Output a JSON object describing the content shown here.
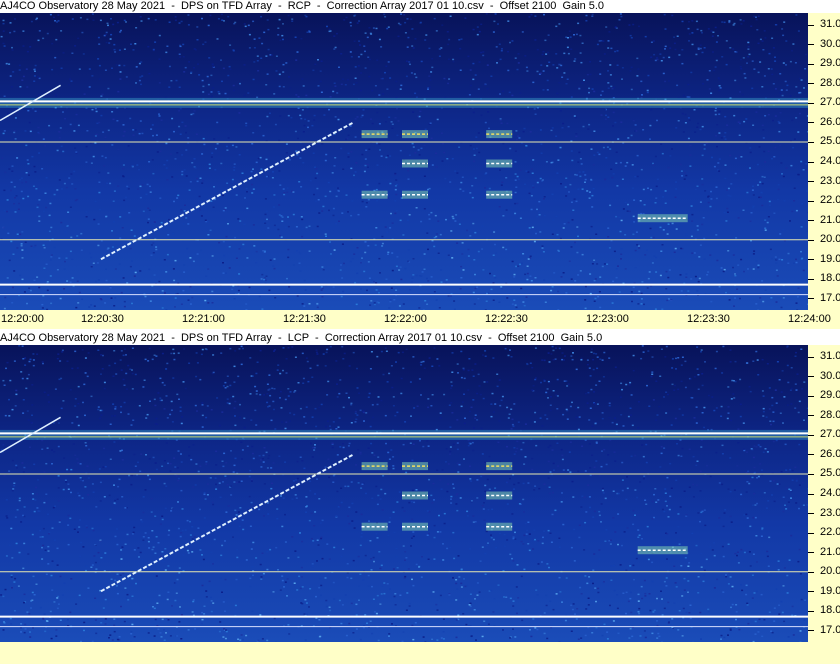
{
  "chart_data": [
    {
      "type": "heatmap",
      "title": "AJ4CO Observatory 28 May 2021  -  DPS on TFD Array  -  RCP  -  Correction Array 2017 01 10.csv  -  Offset 2100  Gain 5.0",
      "x_ticks": [
        "12:20:00",
        "12:20:30",
        "12:21:00",
        "12:21:30",
        "12:22:00",
        "12:22:30",
        "12:23:00",
        "12:23:30",
        "12:24:00"
      ],
      "y_ticks": [
        "31.0",
        "30.0",
        "29.0",
        "28.0",
        "27.0",
        "26.0",
        "25.0",
        "24.0",
        "23.0",
        "22.0",
        "21.0",
        "20.0",
        "19.0",
        "18.0",
        "17.0"
      ],
      "xlim": [
        "12:20:00",
        "12:24:00"
      ],
      "ylim": [
        16.4,
        31.6
      ],
      "interference_lines_mhz": [
        27.0,
        25.0,
        20.0,
        17.7
      ],
      "drifting_signal": {
        "start": [
          "12:20:30",
          19.0
        ],
        "end": [
          "12:21:45",
          26.0
        ]
      },
      "bursts": [
        {
          "time": "12:21:48",
          "mhz": 25.4
        },
        {
          "time": "12:22:00",
          "mhz": 25.4
        },
        {
          "time": "12:22:25",
          "mhz": 25.4
        },
        {
          "time": "12:22:00",
          "mhz": 23.9
        },
        {
          "time": "12:22:25",
          "mhz": 23.9
        },
        {
          "time": "12:21:48",
          "mhz": 22.3
        },
        {
          "time": "12:22:00",
          "mhz": 22.3
        },
        {
          "time": "12:22:25",
          "mhz": 22.3
        },
        {
          "time": "12:23:10",
          "mhz": 21.1
        }
      ]
    },
    {
      "type": "heatmap",
      "title": "AJ4CO Observatory 28 May 2021  -  DPS on TFD Array  -  LCP  -  Correction Array 2017 01 10.csv  -  Offset 2100  Gain 5.0",
      "x_ticks": [],
      "y_ticks": [
        "31.0",
        "30.0",
        "29.0",
        "28.0",
        "27.0",
        "26.0",
        "25.0",
        "24.0",
        "23.0",
        "22.0",
        "21.0",
        "20.0",
        "19.0",
        "18.0",
        "17.0"
      ],
      "xlim": [
        "12:20:00",
        "12:24:00"
      ],
      "ylim": [
        16.4,
        31.6
      ],
      "interference_lines_mhz": [
        27.0,
        25.0,
        20.0,
        17.7
      ],
      "drifting_signal": {
        "start": [
          "12:20:30",
          19.0
        ],
        "end": [
          "12:21:45",
          26.0
        ]
      },
      "bursts": [
        {
          "time": "12:21:48",
          "mhz": 25.4
        },
        {
          "time": "12:22:00",
          "mhz": 25.4
        },
        {
          "time": "12:22:25",
          "mhz": 25.4
        },
        {
          "time": "12:22:00",
          "mhz": 23.9
        },
        {
          "time": "12:22:25",
          "mhz": 23.9
        },
        {
          "time": "12:21:48",
          "mhz": 22.3
        },
        {
          "time": "12:22:00",
          "mhz": 22.3
        },
        {
          "time": "12:22:25",
          "mhz": 22.3
        },
        {
          "time": "12:23:10",
          "mhz": 21.1
        }
      ]
    }
  ]
}
